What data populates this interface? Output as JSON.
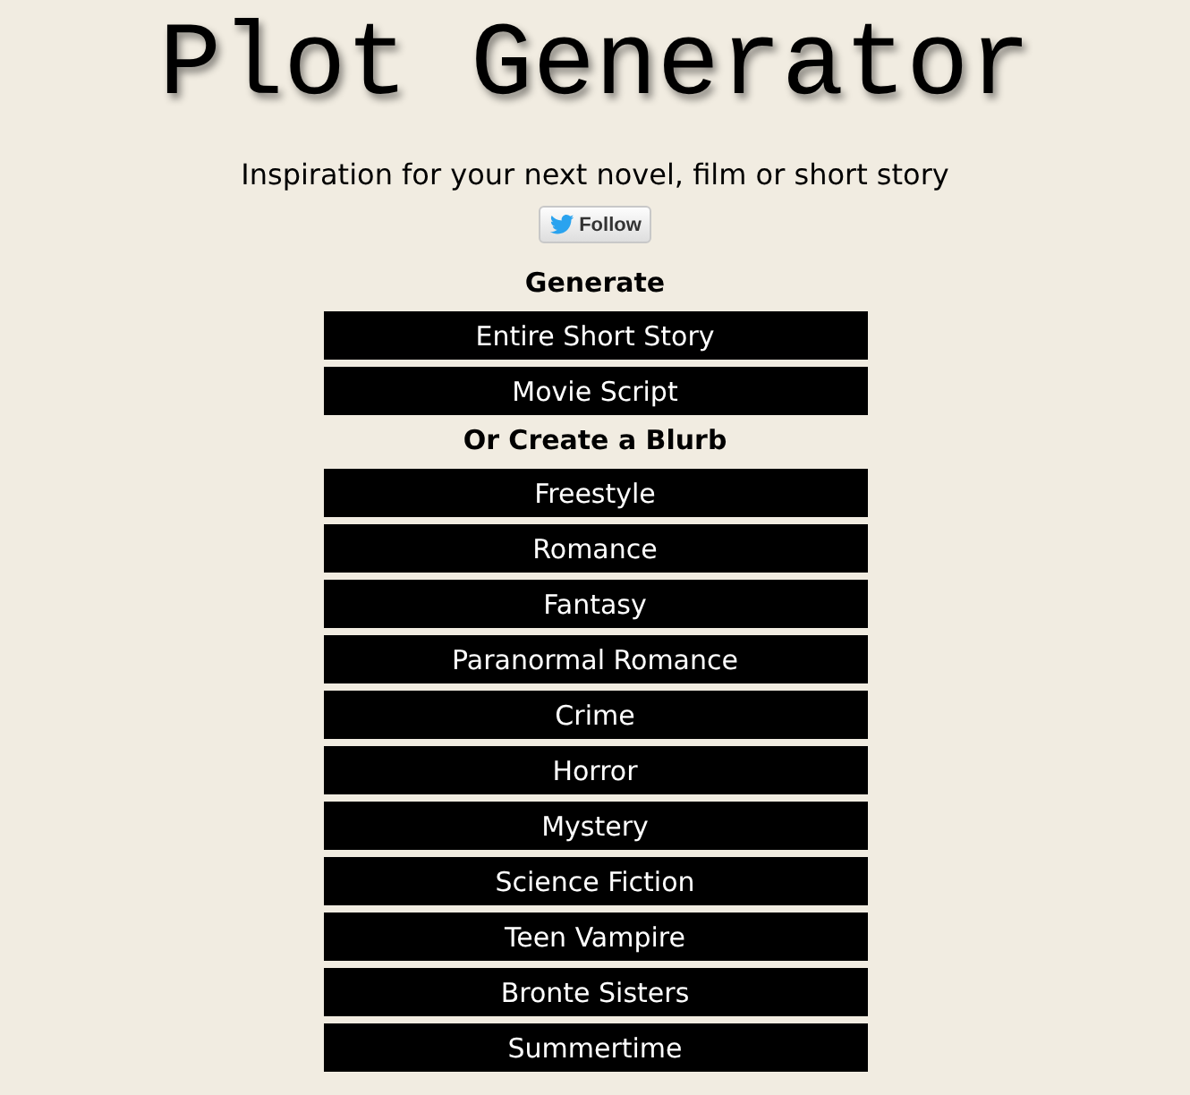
{
  "header": {
    "title": "Plot Generator",
    "tagline": "Inspiration for your next novel, film or short story",
    "follow_button": "Follow"
  },
  "sections": [
    {
      "heading": "Generate",
      "buttons": [
        "Entire Short Story",
        "Movie Script"
      ]
    },
    {
      "heading": "Or Create a Blurb",
      "buttons": [
        "Freestyle",
        "Romance",
        "Fantasy",
        "Paranormal Romance",
        "Crime",
        "Horror",
        "Mystery",
        "Science Fiction",
        "Teen Vampire",
        "Bronte Sisters",
        "Summertime"
      ]
    }
  ]
}
